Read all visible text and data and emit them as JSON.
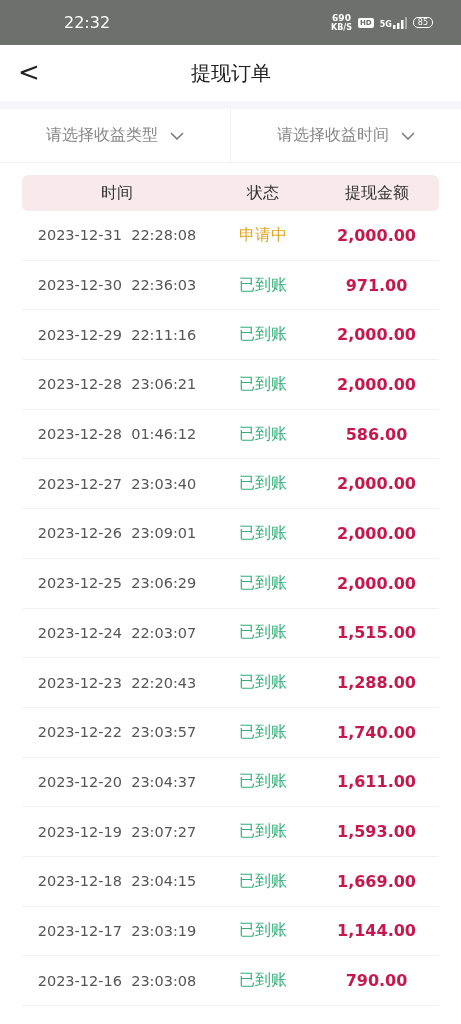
{
  "status_bar": {
    "time": "22:32",
    "speed_value": "690",
    "speed_unit": "KB/S",
    "hd": "HD",
    "network": "5G",
    "battery": "85"
  },
  "header": {
    "back": "<",
    "title": "提现订单"
  },
  "filters": [
    {
      "placeholder": "请选择收益类型"
    },
    {
      "placeholder": "请选择收益时间"
    }
  ],
  "table": {
    "columns": [
      "时间",
      "状态",
      "提现金额"
    ],
    "rows": [
      {
        "date": "2023-12-31",
        "time": "22:28:08",
        "status": "申请中",
        "kind": "pending",
        "amount": "2,000.00"
      },
      {
        "date": "2023-12-30",
        "time": "22:36:03",
        "status": "已到账",
        "kind": "done",
        "amount": "971.00"
      },
      {
        "date": "2023-12-29",
        "time": "22:11:16",
        "status": "已到账",
        "kind": "done",
        "amount": "2,000.00"
      },
      {
        "date": "2023-12-28",
        "time": "23:06:21",
        "status": "已到账",
        "kind": "done",
        "amount": "2,000.00"
      },
      {
        "date": "2023-12-28",
        "time": "01:46:12",
        "status": "已到账",
        "kind": "done",
        "amount": "586.00"
      },
      {
        "date": "2023-12-27",
        "time": "23:03:40",
        "status": "已到账",
        "kind": "done",
        "amount": "2,000.00"
      },
      {
        "date": "2023-12-26",
        "time": "23:09:01",
        "status": "已到账",
        "kind": "done",
        "amount": "2,000.00"
      },
      {
        "date": "2023-12-25",
        "time": "23:06:29",
        "status": "已到账",
        "kind": "done",
        "amount": "2,000.00"
      },
      {
        "date": "2023-12-24",
        "time": "22:03:07",
        "status": "已到账",
        "kind": "done",
        "amount": "1,515.00"
      },
      {
        "date": "2023-12-23",
        "time": "22:20:43",
        "status": "已到账",
        "kind": "done",
        "amount": "1,288.00"
      },
      {
        "date": "2023-12-22",
        "time": "23:03:57",
        "status": "已到账",
        "kind": "done",
        "amount": "1,740.00"
      },
      {
        "date": "2023-12-20",
        "time": "23:04:37",
        "status": "已到账",
        "kind": "done",
        "amount": "1,611.00"
      },
      {
        "date": "2023-12-19",
        "time": "23:07:27",
        "status": "已到账",
        "kind": "done",
        "amount": "1,593.00"
      },
      {
        "date": "2023-12-18",
        "time": "23:04:15",
        "status": "已到账",
        "kind": "done",
        "amount": "1,669.00"
      },
      {
        "date": "2023-12-17",
        "time": "23:03:19",
        "status": "已到账",
        "kind": "done",
        "amount": "1,144.00"
      },
      {
        "date": "2023-12-16",
        "time": "23:03:08",
        "status": "已到账",
        "kind": "done",
        "amount": "790.00"
      }
    ]
  }
}
